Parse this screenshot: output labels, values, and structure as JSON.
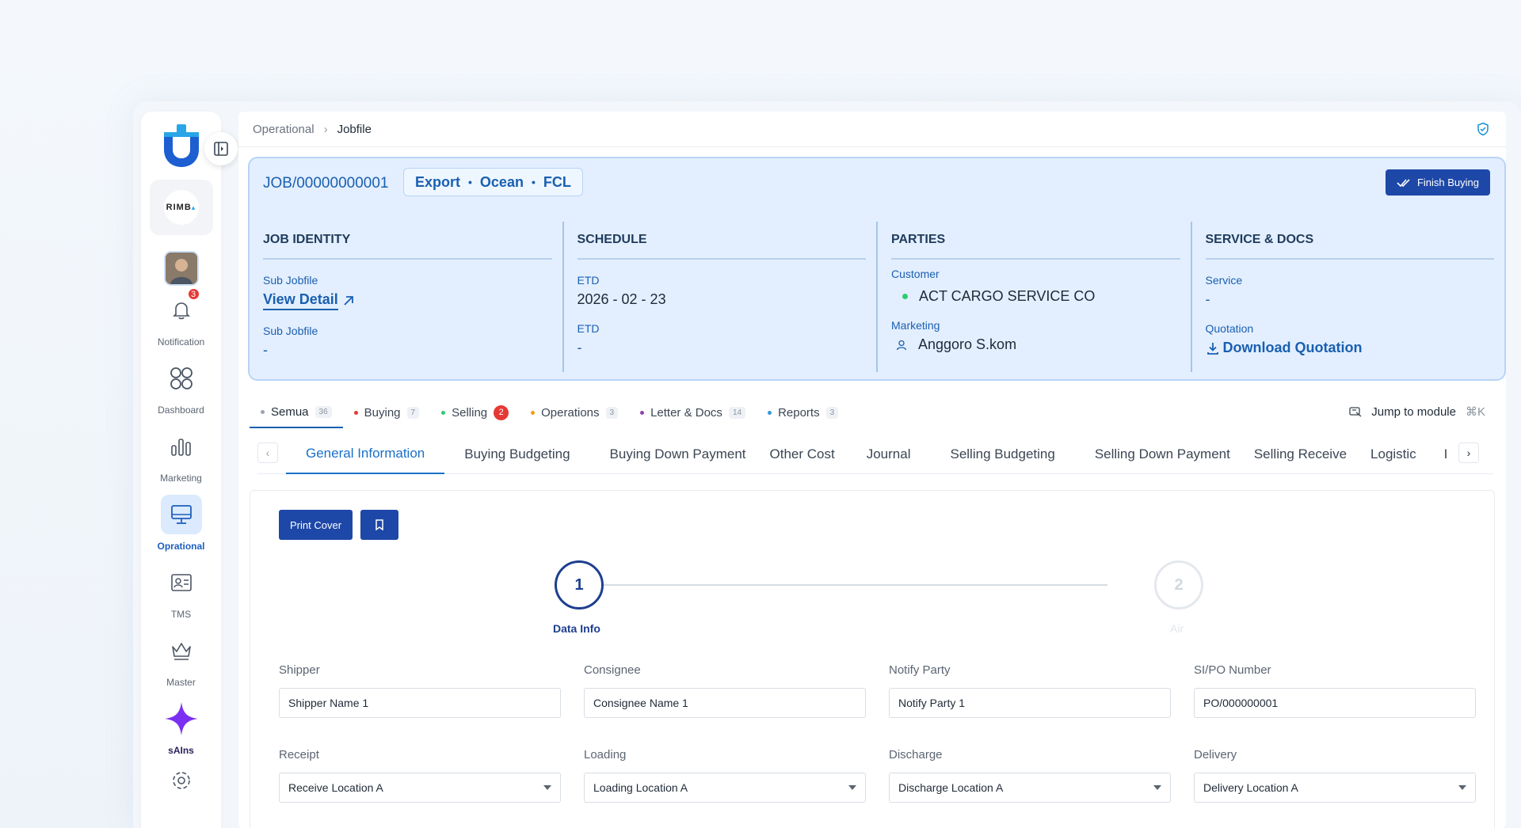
{
  "breadcrumb": {
    "parent": "Operational",
    "current": "Jobfile"
  },
  "sidebar": {
    "org_name": "RIMB",
    "notification_count": "3",
    "items": [
      {
        "label": "Notification",
        "icon": "bell-icon"
      },
      {
        "label": "Dashboard",
        "icon": "grid-icon"
      },
      {
        "label": "Marketing",
        "icon": "bar-chart-icon"
      },
      {
        "label": "Oprational",
        "icon": "monitor-icon",
        "active": true
      },
      {
        "label": "TMS",
        "icon": "id-card-icon"
      },
      {
        "label": "Master",
        "icon": "crown-icon"
      },
      {
        "label": "sAIns",
        "icon": "sparkle-icon"
      }
    ]
  },
  "job": {
    "number": "JOB/00000000001",
    "tags": [
      "Export",
      "Ocean",
      "FCL"
    ],
    "finish_button": "Finish Buying",
    "identity": {
      "title": "JOB IDENTITY",
      "label1": "Sub Jobfile",
      "value1": "View Detail",
      "label2": "Sub Jobfile",
      "value2": "-"
    },
    "schedule": {
      "title": "SCHEDULE",
      "label1": "ETD",
      "value1": "2026 - 02 - 23",
      "label2": "ETD",
      "value2": "-"
    },
    "parties": {
      "title": "PARTIES",
      "label1": "Customer",
      "value1": "ACT CARGO SERVICE CO",
      "label2": "Marketing",
      "value2": "Anggoro S.kom"
    },
    "service": {
      "title": "SERVICE & DOCS",
      "label1": "Service",
      "value1": "-",
      "label2": "Quotation",
      "value2": "Download Quotation"
    }
  },
  "module_tabs": [
    {
      "label": "Semua",
      "count": "36",
      "dot": "#9aa3ae",
      "active": true
    },
    {
      "label": "Buying",
      "count": "7",
      "dot": "#e53935"
    },
    {
      "label": "Selling",
      "count": "2",
      "dot": "#2ecc71",
      "red": true
    },
    {
      "label": "Operations",
      "count": "3",
      "dot": "#f39c12"
    },
    {
      "label": "Letter & Docs",
      "count": "14",
      "dot": "#8e44ad"
    },
    {
      "label": "Reports",
      "count": "3",
      "dot": "#3498db"
    }
  ],
  "jump_module": {
    "label": "Jump to module",
    "shortcut": "⌘K"
  },
  "sub_tabs": [
    "General Information",
    "Buying Budgeting",
    "Buying Down Payment",
    "Other Cost",
    "Journal",
    "Selling Budgeting",
    "Selling Down Payment",
    "Selling Receive",
    "Logistic",
    "I"
  ],
  "form": {
    "print_button": "Print Cover",
    "steps": [
      {
        "num": "1",
        "label": "Data Info"
      },
      {
        "num": "2",
        "label": "Air"
      }
    ],
    "row1": [
      {
        "label": "Shipper",
        "value": "Shipper Name 1"
      },
      {
        "label": "Consignee",
        "value": "Consignee Name 1"
      },
      {
        "label": "Notify Party",
        "value": "Notify Party 1"
      },
      {
        "label": "SI/PO Number",
        "value": "PO/000000001"
      }
    ],
    "row2": [
      {
        "label": "Receipt",
        "value": "Receive Location A"
      },
      {
        "label": "Loading",
        "value": "Loading Location A"
      },
      {
        "label": "Discharge",
        "value": "Discharge Location A"
      },
      {
        "label": "Delivery",
        "value": "Delivery Location A"
      }
    ]
  }
}
